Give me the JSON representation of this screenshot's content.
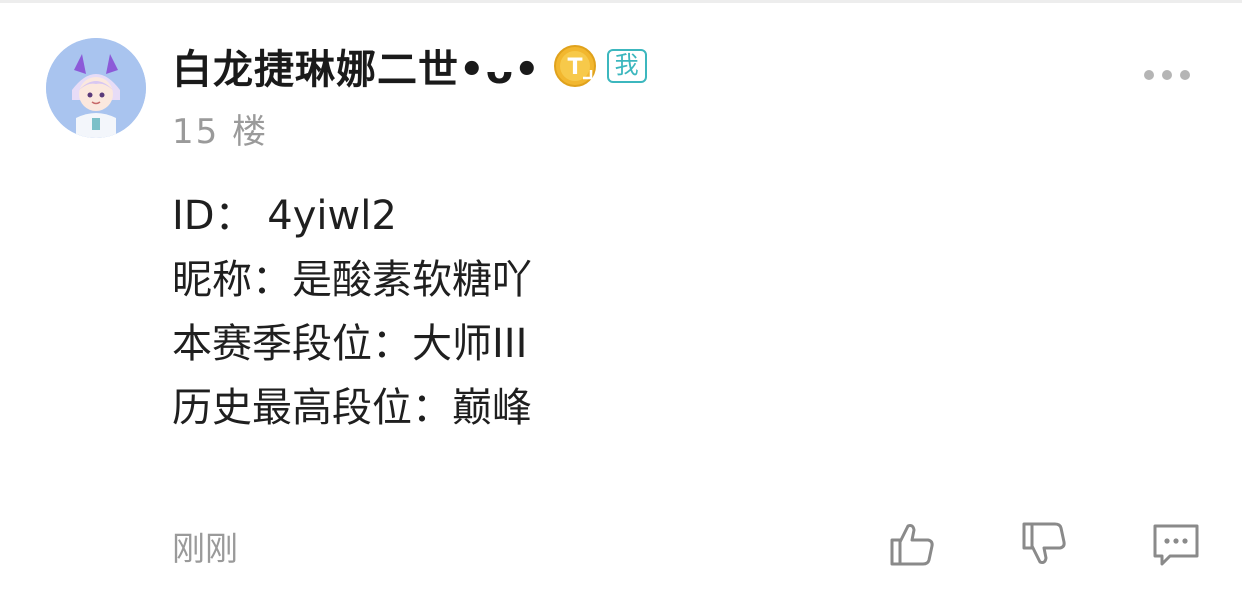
{
  "post": {
    "author": {
      "name": "白龙捷琳娜二世•ᴗ•",
      "badge_level_icon": "level-t-coin-icon",
      "me_badge": "我",
      "avatar": "cartoon-avatar"
    },
    "floor": "15 楼",
    "content": [
      "ID：  4yiwl2",
      "昵称：是酸素软糖吖",
      "本赛季段位：大师III",
      "历史最高段位：巅峰"
    ],
    "time": "刚刚",
    "actions": {
      "like": "thumbs-up-icon",
      "dislike": "thumbs-down-icon",
      "reply": "comment-icon",
      "more": "more-icon"
    }
  },
  "colors": {
    "accent_teal": "#3cb7be",
    "muted_text": "#9a9a9a",
    "main_text": "#1f1f1f",
    "avatar_bg": "#a9c4ef",
    "coin_gold": "#f2b72f"
  }
}
